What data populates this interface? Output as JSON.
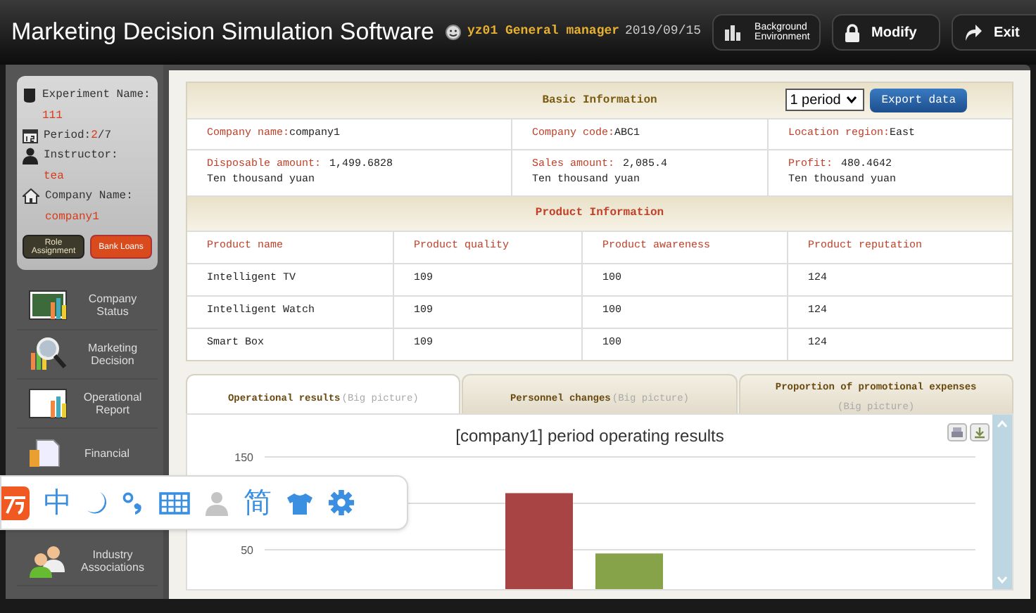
{
  "window": {
    "title": "Marketing Decision Simulation Software"
  },
  "header": {
    "user": "yz01 General manager",
    "date": "2019/09/15",
    "buttons": [
      {
        "kind": "background",
        "label": "Background Environment"
      },
      {
        "kind": "modify",
        "label": "Modify"
      },
      {
        "kind": "exit",
        "label": "Exit"
      }
    ]
  },
  "info_card": {
    "fields": [
      {
        "kind": "experiment",
        "label": "Experiment Name:",
        "value": "111"
      },
      {
        "kind": "period",
        "label": "Period:",
        "value": "2",
        "total": "/7"
      },
      {
        "kind": "instructor",
        "label": "Instructor:",
        "value": "tea"
      },
      {
        "kind": "company",
        "label": "Company Name:",
        "value": "company1"
      }
    ],
    "buttons": [
      {
        "kind": "dark",
        "label": "Role Assignment"
      },
      {
        "kind": "orange",
        "label": "Bank Loans"
      }
    ]
  },
  "sidebar": {
    "items": [
      {
        "kind": "status",
        "label": "Company Status"
      },
      {
        "kind": "decision",
        "label": "Marketing Decision"
      },
      {
        "kind": "report",
        "label": "Operational Report"
      },
      {
        "kind": "financial",
        "label": "Financial"
      },
      {
        "kind": "associations",
        "label": "Industry Associations"
      }
    ]
  },
  "basic_information": {
    "title": "Basic Information",
    "period_select": "1 period",
    "export_button": "Export data",
    "rows": [
      [
        {
          "label": "Company name:",
          "value": "company1"
        },
        {
          "label": "Company code:",
          "value": "ABC1"
        },
        {
          "label": "Location region:",
          "value": "East"
        }
      ],
      [
        {
          "label": "Disposable amount:",
          "value": "1,499.6828",
          "unit": "Ten thousand yuan"
        },
        {
          "label": "Sales amount:",
          "value": "2,085.4",
          "unit": "Ten thousand yuan"
        },
        {
          "label": "Profit:",
          "value": "480.4642",
          "unit": "Ten thousand yuan"
        }
      ]
    ]
  },
  "product_information": {
    "title": "Product Information",
    "columns": [
      "Product name",
      "Product quality",
      "Product awareness",
      "Product reputation"
    ],
    "rows": [
      [
        "Intelligent TV",
        "109",
        "100",
        "124"
      ],
      [
        "Intelligent Watch",
        "109",
        "100",
        "124"
      ],
      [
        "Smart Box",
        "109",
        "100",
        "124"
      ]
    ]
  },
  "tabs": [
    {
      "label": "Operational results",
      "hint": "(Big picture)",
      "selected": true
    },
    {
      "label": "Personnel changes",
      "hint": "(Big picture)",
      "selected": false
    },
    {
      "label": "Proportion of promotional expenses",
      "hint": "(Big picture)",
      "selected": false
    }
  ],
  "chart": {
    "chart_data": {
      "type": "bar",
      "title": "[company1] period operating results",
      "ylim": [
        0,
        150
      ],
      "yticks": [
        50,
        150
      ],
      "stacked": false,
      "series": [
        {
          "color": "#a84444",
          "values": [
            111
          ]
        },
        {
          "color": "#86a34a",
          "values": [
            46
          ]
        }
      ]
    }
  },
  "ime_toolbar": {
    "mode": "中",
    "script": "简"
  }
}
